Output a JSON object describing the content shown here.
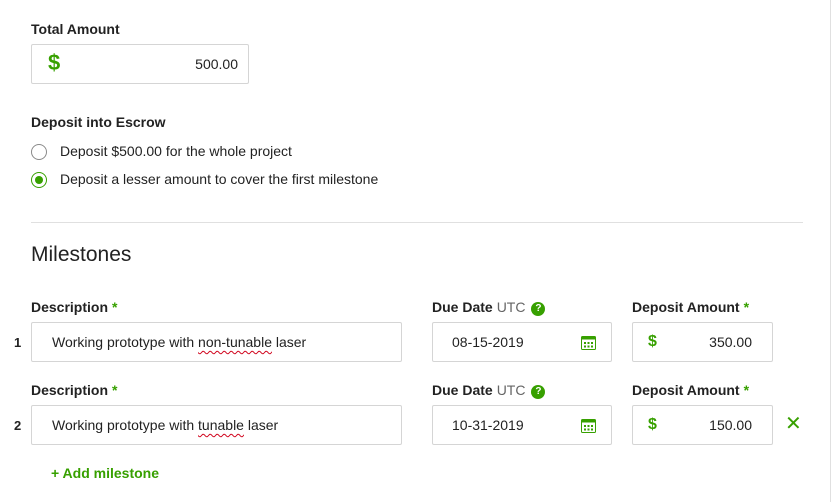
{
  "total_amount": {
    "label": "Total Amount",
    "currency_symbol": "$",
    "value": "500.00"
  },
  "escrow": {
    "label": "Deposit into Escrow",
    "options": [
      {
        "label": "Deposit $500.00 for the whole project",
        "checked": false
      },
      {
        "label": "Deposit a lesser amount to cover the first milestone",
        "checked": true
      }
    ]
  },
  "milestones": {
    "title": "Milestones",
    "description_label": "Description",
    "due_date_label": "Due Date",
    "due_date_tz": "UTC",
    "deposit_label": "Deposit Amount",
    "required_mark": "*",
    "help_glyph": "?",
    "currency_symbol": "$",
    "rows": [
      {
        "number": "1",
        "description_before": "Working prototype with ",
        "description_misspelled": "non-tunable",
        "description_after": " laser",
        "due_date": "08-15-2019",
        "amount": "350.00",
        "removable": false
      },
      {
        "number": "2",
        "description_before": "Working prototype with ",
        "description_misspelled": "tunable",
        "description_after": " laser",
        "due_date": "10-31-2019",
        "amount": "150.00",
        "removable": true
      }
    ],
    "remove_glyph": "✕",
    "add_label": "+ Add milestone"
  },
  "colors": {
    "accent": "#37a000",
    "border": "#d5d5d5",
    "divider": "#e0e0e0",
    "text": "#222222",
    "muted": "#656565"
  }
}
